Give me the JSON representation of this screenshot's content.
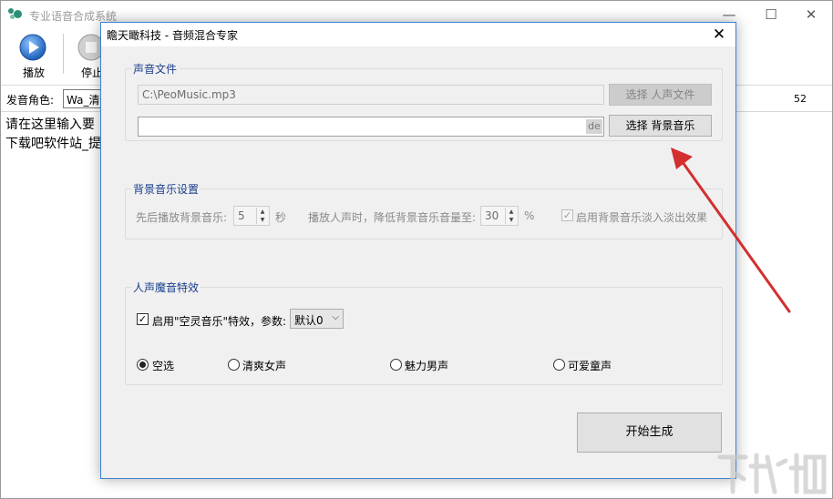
{
  "main_window": {
    "title": "专业语音合成系统",
    "controls": {
      "minimize": "—",
      "maximize": "☐",
      "close": "✕"
    },
    "toolbar": [
      {
        "label": "播放",
        "icon": "play-icon"
      },
      {
        "label": "停止",
        "icon": "stop-icon"
      }
    ],
    "voice_label": "发音角色:",
    "voice_value": "Wa_清",
    "voice_number": "52",
    "text_lines": [
      "请在这里输入要",
      "下载吧软件站_提"
    ]
  },
  "dialog": {
    "title": "瞻天瞰科技 - 音频混合专家",
    "close": "✕",
    "sound_file": {
      "legend": "声音文件",
      "voice_path": "C:\\PeoMusic.mp3",
      "voice_button": "选择 人声文件",
      "bg_path": "",
      "bg_badge": "de",
      "bg_button": "选择 背景音乐"
    },
    "bg_settings": {
      "legend": "背景音乐设置",
      "delay_label": "先后播放背景音乐:",
      "delay_value": "5",
      "delay_unit": "秒",
      "reduce_label": "播放人声时，降低背景音乐音量至:",
      "reduce_value": "30",
      "reduce_unit": "%",
      "fade_label": "启用背景音乐淡入淡出效果",
      "fade_checked": true
    },
    "effects": {
      "legend": "人声魔音特效",
      "enable_label": "启用\"空灵音乐\"特效，参数:",
      "enable_checked": true,
      "param_value": "默认0",
      "options": [
        {
          "label": "空选",
          "checked": true
        },
        {
          "label": "清爽女声",
          "checked": false
        },
        {
          "label": "魅力男声",
          "checked": false
        },
        {
          "label": "可爱童声",
          "checked": false
        }
      ]
    },
    "start_button": "开始生成"
  },
  "colors": {
    "annotation_arrow": "#d32f2f",
    "dialog_border": "#3b82d0",
    "legend_text": "#1a3e8c"
  }
}
